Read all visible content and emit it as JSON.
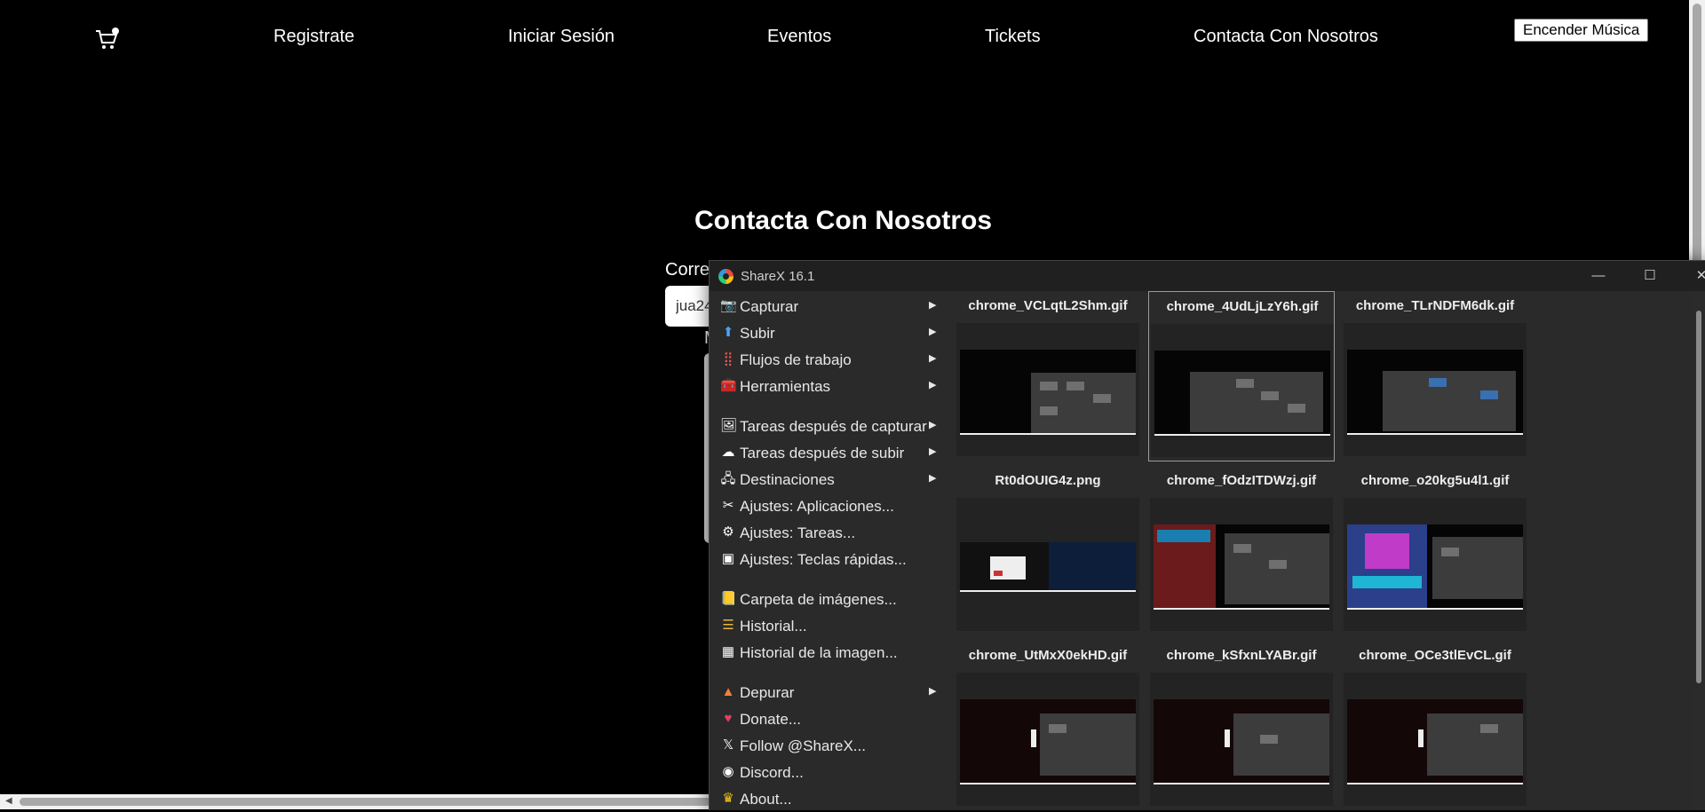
{
  "site": {
    "nav": {
      "cart_icon": "cart-icon",
      "links": [
        "Registrate",
        "Iniciar Sesión",
        "Eventos",
        "Tickets",
        "Contacta Con Nosotros"
      ],
      "music_button": "Encender Música"
    },
    "contact": {
      "title": "Contacta Con Nosotros",
      "email_label": "Corre",
      "email_value": "jua24",
      "message_label": "M"
    }
  },
  "sharex": {
    "title": "ShareX 16.1",
    "menu": [
      {
        "label": "Capturar",
        "icon": "capture-icon",
        "submenu": true
      },
      {
        "label": "Subir",
        "icon": "upload-arrow-icon",
        "submenu": true
      },
      {
        "label": "Flujos de trabajo",
        "icon": "workflows-grid-icon",
        "submenu": true
      },
      {
        "label": "Herramientas",
        "icon": "toolbox-icon",
        "submenu": true
      },
      {
        "label": "Tareas después de capturar",
        "icon": "after-capture-icon",
        "submenu": true
      },
      {
        "label": "Tareas después de subir",
        "icon": "after-upload-icon",
        "submenu": true
      },
      {
        "label": "Destinaciones",
        "icon": "destinations-icon",
        "submenu": true
      },
      {
        "label": "Ajustes: Aplicaciones...",
        "icon": "app-settings-icon",
        "submenu": false
      },
      {
        "label": "Ajustes: Tareas...",
        "icon": "task-settings-gear-icon",
        "submenu": false
      },
      {
        "label": "Ajustes: Teclas rápidas...",
        "icon": "hotkey-settings-icon",
        "submenu": false
      },
      {
        "label": "Carpeta de imágenes...",
        "icon": "image-folder-icon",
        "submenu": false
      },
      {
        "label": "Historial...",
        "icon": "history-icon",
        "submenu": false
      },
      {
        "label": "Historial de la imagen...",
        "icon": "image-history-icon",
        "submenu": false
      },
      {
        "label": "Depurar",
        "icon": "debug-cone-icon",
        "submenu": true
      },
      {
        "label": "Donate...",
        "icon": "heart-icon",
        "submenu": false
      },
      {
        "label": "Follow @ShareX...",
        "icon": "x-logo-icon",
        "submenu": false
      },
      {
        "label": "Discord...",
        "icon": "discord-icon",
        "submenu": false
      },
      {
        "label": "About...",
        "icon": "crown-icon",
        "submenu": false
      }
    ],
    "thumbnails": [
      {
        "name": "chrome_VCLqtL2Shm.gif",
        "selected": false
      },
      {
        "name": "chrome_4UdLjLzY6h.gif",
        "selected": true
      },
      {
        "name": "chrome_TLrNDFM6dk.gif",
        "selected": false
      },
      {
        "name": "Rt0dOUIG4z.png",
        "selected": false
      },
      {
        "name": "chrome_fOdzITDWzj.gif",
        "selected": false
      },
      {
        "name": "chrome_o20kg5u4l1.gif",
        "selected": false
      },
      {
        "name": "chrome_UtMxX0ekHD.gif",
        "selected": false
      },
      {
        "name": "chrome_kSfxnLYABr.gif",
        "selected": false
      },
      {
        "name": "chrome_OCe3tlEvCL.gif",
        "selected": false
      }
    ],
    "colors": {
      "window_bg": "#2a2a2a",
      "titlebar_bg": "#202020"
    }
  }
}
